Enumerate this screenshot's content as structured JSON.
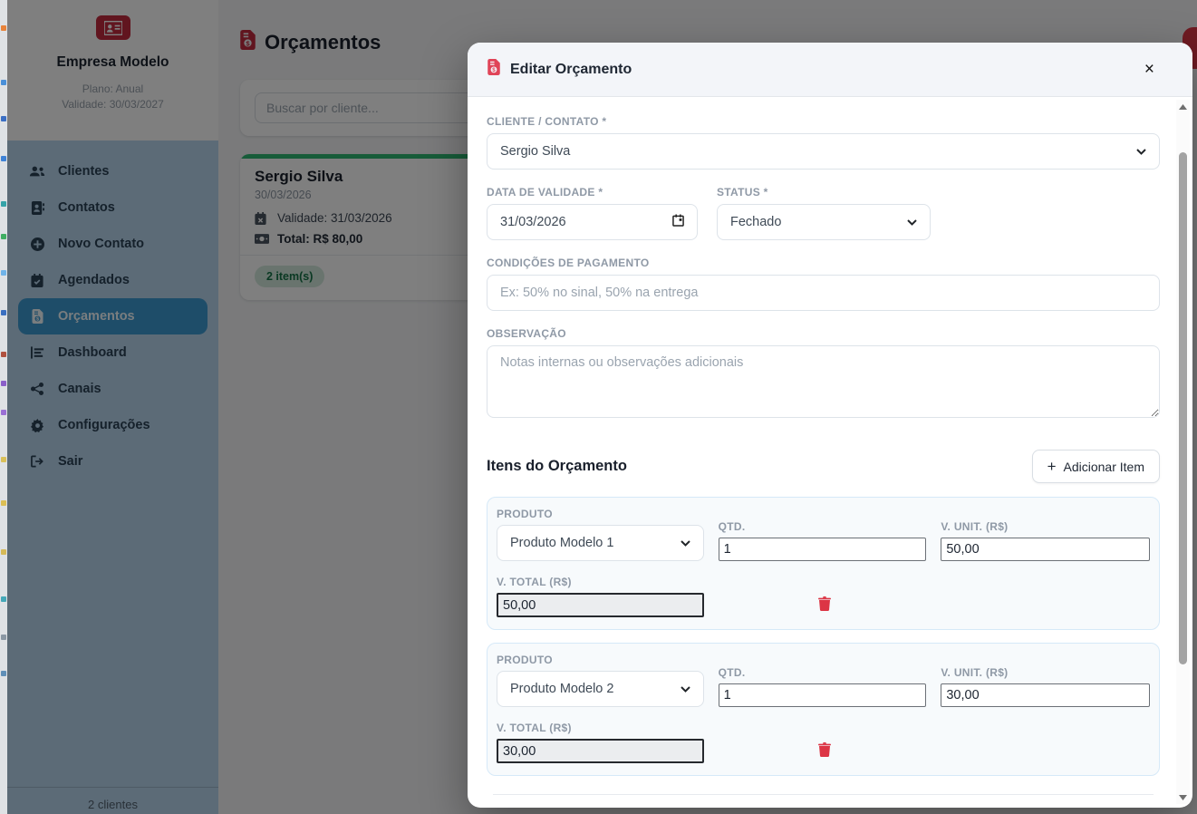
{
  "app": {
    "brand": {
      "company": "Empresa Modelo",
      "plan": "Plano: Anual",
      "validity": "Validade: 30/03/2027"
    },
    "sidebar": {
      "nav": [
        {
          "label": "Clientes"
        },
        {
          "label": "Contatos"
        },
        {
          "label": "Novo Contato"
        },
        {
          "label": "Agendados"
        },
        {
          "label": "Orçamentos"
        },
        {
          "label": "Dashboard"
        },
        {
          "label": "Canais"
        },
        {
          "label": "Configurações"
        },
        {
          "label": "Sair"
        }
      ],
      "footer": "2 clientes"
    },
    "main": {
      "title": "Orçamentos",
      "search_placeholder": "Buscar por cliente...",
      "card": {
        "name": "Sergio Silva",
        "date": "30/03/2026",
        "validity": "Validade: 31/03/2026",
        "total": "Total: R$ 80,00",
        "badge": "2 item(s)"
      }
    },
    "modal": {
      "title": "Editar Orçamento",
      "close": "×",
      "fields": {
        "client_label": "CLIENTE / CONTATO *",
        "client_value": "Sergio Silva",
        "date_label": "DATA DE VALIDADE *",
        "date_value": "31/03/2026",
        "status_label": "STATUS *",
        "status_value": "Fechado",
        "payment_label": "CONDIÇÕES DE PAGAMENTO",
        "payment_placeholder": "Ex: 50% no sinal, 50% na entrega",
        "notes_label": "OBSERVAÇÃO",
        "notes_placeholder": "Notas internas ou observações adicionais"
      },
      "items_heading": "Itens do Orçamento",
      "add_item_label": "Adicionar Item",
      "add_item_plus": "+",
      "item_labels": {
        "product": "PRODUTO",
        "qty": "QTD.",
        "unit": "V. UNIT. (R$)",
        "total": "V. TOTAL (R$)"
      },
      "items": [
        {
          "product": "Produto Modelo 1",
          "qty": "1",
          "unit": "50,00",
          "total": "50,00"
        },
        {
          "product": "Produto Modelo 2",
          "qty": "1",
          "unit": "30,00",
          "total": "30,00"
        }
      ]
    },
    "colors": {
      "brand_red": "#dc3545",
      "active_blue": "#3d9ad2",
      "success_green": "#2eb873",
      "badge_bg": "#d1e7dd",
      "badge_text": "#157347"
    }
  }
}
